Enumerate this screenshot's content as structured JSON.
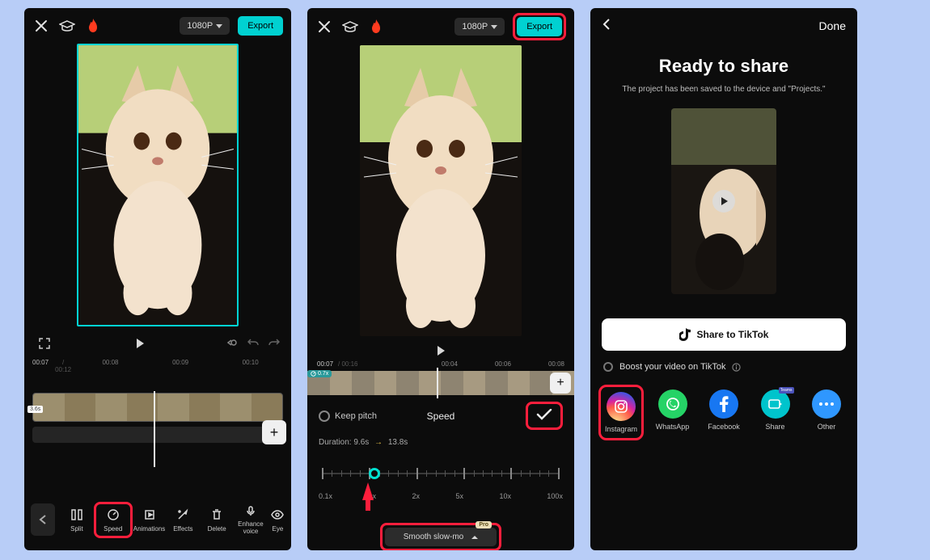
{
  "panel1": {
    "resolution": "1080P",
    "export_label": "Export",
    "time_current": "00:07",
    "time_total": "00:12",
    "marks": [
      "00:08",
      "00:09",
      "00:10"
    ],
    "clip_badge": "3.6s",
    "tools": {
      "split": "Split",
      "speed": "Speed",
      "animations": "Animations",
      "effects": "Effects",
      "delete": "Delete",
      "enhance": "Enhance voice",
      "eye": "Eye"
    }
  },
  "panel2": {
    "resolution": "1080P",
    "export_label": "Export",
    "time_current": "00:07",
    "time_total": "00:16",
    "marks": [
      "00:04",
      "00:06",
      "00:08"
    ],
    "clip_badge": "0.7x",
    "keep_pitch": "Keep pitch",
    "speed_title": "Speed",
    "duration_label": "Duration:",
    "duration_from": "9.6s",
    "duration_to": "13.8s",
    "slider_labels": [
      "0.1x",
      "1x",
      "2x",
      "5x",
      "10x",
      "100x"
    ],
    "smooth_label": "Smooth slow-mo",
    "pro_label": "Pro"
  },
  "panel3": {
    "done": "Done",
    "title": "Ready to share",
    "subtitle": "The project has been saved to the device and \"Projects.\"",
    "tiktok_label": "Share to TikTok",
    "boost_label": "Boost your video on TikTok",
    "share": {
      "instagram": "Instagram",
      "whatsapp": "WhatsApp",
      "facebook": "Facebook",
      "share": "Share",
      "other": "Other"
    }
  }
}
